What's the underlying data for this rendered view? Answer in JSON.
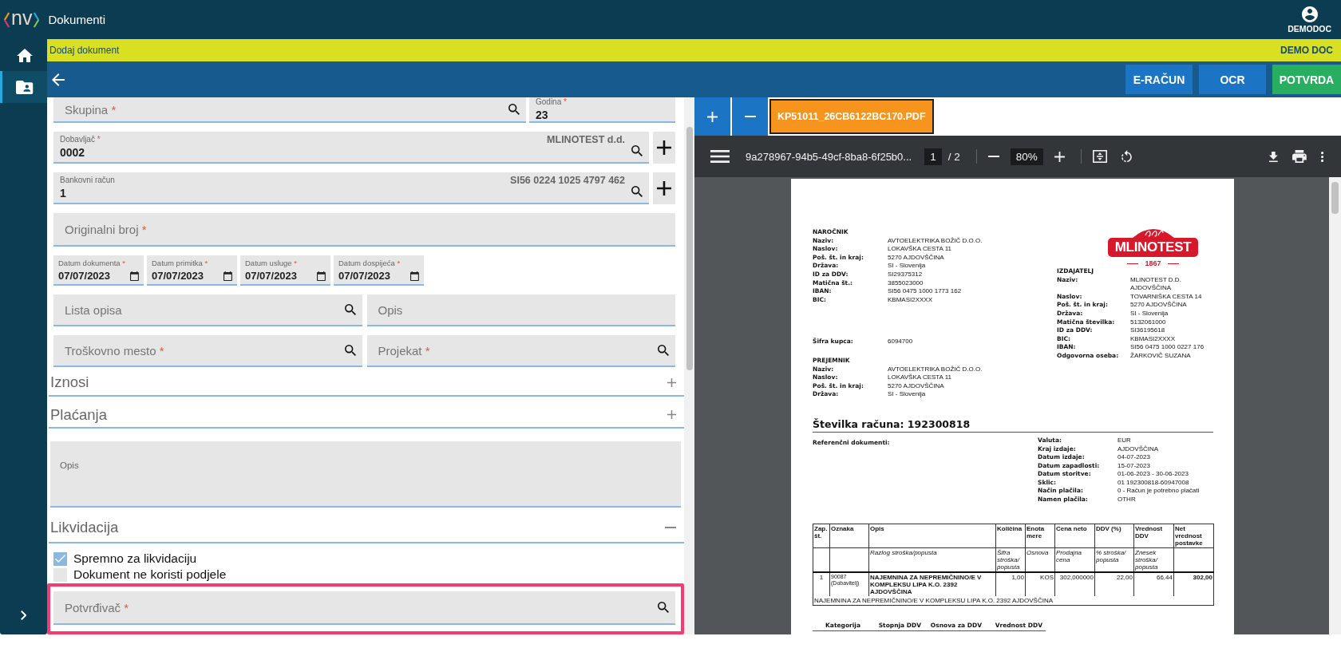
{
  "app": {
    "logo": "nv",
    "title": "Dokumenti",
    "user": "DEMODOC"
  },
  "sidebar": {
    "items": [
      {
        "kind": "home",
        "selected": false
      },
      {
        "kind": "documents",
        "selected": true
      }
    ]
  },
  "breadcrumb": {
    "title": "Dodaj dokument",
    "company": "DEMO DOC"
  },
  "actions": [
    {
      "label": "E-RAČUN",
      "kind": "secondary"
    },
    {
      "label": "OCR",
      "kind": "secondary"
    },
    {
      "label": "POTVRDA",
      "kind": "primary"
    }
  ],
  "form": {
    "rows": [
      {
        "kind": "pair",
        "fields": [
          {
            "label": "Skupina",
            "required_mark": "*",
            "search": true
          },
          {
            "label": "Godina",
            "required_mark": "*",
            "value": "23"
          }
        ]
      },
      {
        "kind": "single",
        "fields": [
          {
            "label": "Dobavljač",
            "required_mark": "*",
            "value": "0002",
            "extra": "MLINOTEST d.d.",
            "search": true,
            "addable": true
          }
        ]
      },
      {
        "kind": "single",
        "fields": [
          {
            "label": "Bankovni račun",
            "value": "1",
            "extra": "SI56 0224 1025 4797 462",
            "search": true,
            "addable": true
          }
        ]
      },
      {
        "kind": "single",
        "fields": [
          {
            "label": "Originalni broj",
            "required_mark": "*"
          }
        ]
      },
      {
        "kind": "dates",
        "fields": [
          {
            "label": "Datum dokumenta",
            "required_mark": "*",
            "value": "07/07/2023"
          },
          {
            "label": "Datum primitka",
            "required_mark": "*",
            "value": "07/07/2023"
          },
          {
            "label": "Datum usluge",
            "required_mark": "*",
            "value": "07/07/2023"
          },
          {
            "label": "Datum dospijeća",
            "required_mark": "*",
            "value": "07/07/2023"
          }
        ]
      },
      {
        "kind": "halves",
        "fields": [
          {
            "label": "Lista opisa",
            "search": true
          },
          {
            "label": "Opis"
          }
        ]
      },
      {
        "kind": "halves",
        "fields": [
          {
            "label": "Troškovno mesto",
            "required_mark": "*",
            "search": true
          },
          {
            "label": "Projekat",
            "required_mark": "*",
            "search": true
          }
        ]
      },
      {
        "kind": "section",
        "title": "Iznosi",
        "expanded": false
      },
      {
        "kind": "section",
        "title": "Plaćanja",
        "expanded": false
      },
      {
        "kind": "textarea",
        "label": "Opis"
      },
      {
        "kind": "section",
        "title": "Likvidacija",
        "expanded": true
      },
      {
        "kind": "checkbox",
        "label": "Spremno za likvidaciju",
        "checked": true
      },
      {
        "kind": "checkbox",
        "label": "Dokument ne koristi podjele",
        "checked": false
      },
      {
        "kind": "single",
        "highlighted": true,
        "fields": [
          {
            "label": "Potvrđivač",
            "required_mark": "*",
            "search": true
          }
        ]
      }
    ]
  },
  "viewer": {
    "files": [
      {
        "name": "KP51011_26CB6122BC170.PDF",
        "selected": true
      }
    ],
    "toolbar": {
      "filename": "9a278967-94b5-49cf-8ba8-6f25b0...",
      "page": "1",
      "page_count": "/ 2",
      "zoom": "80%"
    }
  },
  "document": {
    "buyer": {
      "title": "NAROČNIK",
      "rows": [
        [
          "Naziv:",
          "AVTOELEKTRIKA BOŽIČ D.O.O."
        ],
        [
          "Naslov:",
          "LOKAVŠKA CESTA 11"
        ],
        [
          "Poš. št. in kraj:",
          "5270 AJDOVŠČINA"
        ],
        [
          "Država:",
          "SI - Slovenija"
        ],
        [
          "ID za DDV:",
          "SI29375312"
        ],
        [
          "Matična št.:",
          "3855023000"
        ],
        [
          "IBAN:",
          "SI56 0475 1000 1773 162"
        ],
        [
          "BIC:",
          "KBMASI2XXXX"
        ]
      ]
    },
    "customer_code": [
      "Šifra kupca:",
      "6094700"
    ],
    "recipient": {
      "title": "PREJEMNIK",
      "rows": [
        [
          "Naziv:",
          "AVTOELEKTRIKA BOŽIČ D.O.O."
        ],
        [
          "Naslov:",
          "LOKAVŠKA CESTA 11"
        ],
        [
          "Poš. št. in kraj:",
          "5270 AJDOVŠČINA"
        ],
        [
          "Država:",
          "SI - Slovenija"
        ]
      ]
    },
    "logo": {
      "name": "MLINOTEST",
      "year": "1867"
    },
    "issuer": {
      "title": "IZDAJATELJ",
      "rows": [
        [
          "Naziv:",
          "MLINOTEST D.D.\nAJDOVŠČINA"
        ],
        [
          "Naslov:",
          "TOVARNIŠKA CESTA 14"
        ],
        [
          "Poš. št. in kraj:",
          "5270 AJDOVŠČINA"
        ],
        [
          "Država:",
          "SI - Slovenija"
        ],
        [
          "Matična številka:",
          "5132061000"
        ],
        [
          "ID za DDV:",
          "SI36195618"
        ],
        [
          "BIC:",
          "KBMASI2XXXX"
        ],
        [
          "IBAN:",
          "SI56 0475 1000 0227 176"
        ],
        [
          "Odgovorna oseba:",
          "ŽARKOVIČ SUZANA"
        ]
      ]
    },
    "invoice_title": "Številka računa: 192300818",
    "references_label": "Referenčni dokumenti:",
    "details": [
      [
        "Valuta:",
        "EUR"
      ],
      [
        "Kraj izdaje:",
        "AJDOVŠČINA"
      ],
      [
        "Datum izdaje:",
        "04-07-2023"
      ],
      [
        "Datum zapadlosti:",
        "15-07-2023"
      ],
      [
        "Datum storitve:",
        "01-06-2023 - 30-06-2023"
      ],
      [
        "Sklic:",
        "01 192300818-60947008"
      ],
      [
        "Način plačila:",
        "0 - Račun je potrebno plačati"
      ],
      [
        "Namen plačila:",
        "OTHR"
      ]
    ],
    "items_table": {
      "headers": [
        "Zap. št.",
        "Oznaka",
        "Opis",
        "Količina",
        "Enota mere",
        "Cena neto",
        "DDV (%)",
        "Vrednost DDV",
        "Net vrednost postavke"
      ],
      "subheaders": [
        "Razlog stroška/popusta",
        "Šifra stroška/ popusta",
        "Osnova",
        "Prodajna cena",
        "% stroška/ popusta",
        "Znesek stroška/ popusta"
      ],
      "rows": [
        {
          "number": "1",
          "code": "90087",
          "code_note": "(Dobavitelj)",
          "cells": [
            "NAJEMNINA ZA NEPREMIČNINO/E V KOMPLEKSU LIPA K.O. 2392 AJDOVŠČINA",
            "1,00",
            "KOS",
            "302,000000",
            "22,00",
            "66,44",
            "302,00"
          ],
          "note": "NAJEMNINA ZA NEPREMIČNINO/E V KOMPLEKSU LIPA K.O. 2392 AJDOVŠČINA"
        }
      ]
    },
    "vat_summary": {
      "headers": [
        "Kategorija",
        "Stopnja DDV",
        "Osnova za DDV",
        "Vrednost DDV"
      ]
    }
  }
}
